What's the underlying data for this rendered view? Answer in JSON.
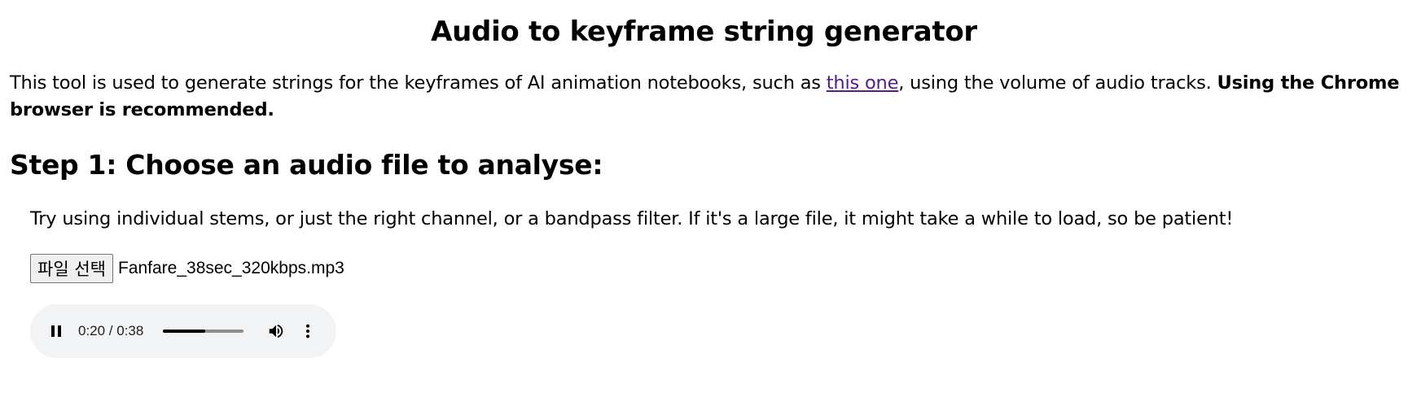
{
  "header": {
    "title": "Audio to keyframe string generator"
  },
  "intro": {
    "text_before_link": "This tool is used to generate strings for the keyframes of AI animation notebooks, such as ",
    "link_text": "this one",
    "text_after_link": ", using the volume of audio tracks. ",
    "bold_text": "Using the Chrome browser is recommended."
  },
  "step1": {
    "heading": "Step 1: Choose an audio file to analyse:",
    "hint": "Try using individual stems, or just the right channel, or a bandpass filter. If it's a large file, it might take a while to load, so be patient!",
    "file_button_label": "파일 선택",
    "file_name": "Fanfare_38sec_320kbps.mp3"
  },
  "audio_player": {
    "time_display": "0:20 / 0:38",
    "progress_fraction": 0.526,
    "play_state_icon": "pause-icon",
    "volume_icon": "volume-icon",
    "menu_icon": "more-vert-icon"
  },
  "colors": {
    "link": "#551a8b",
    "player_background": "#f1f3f4"
  }
}
